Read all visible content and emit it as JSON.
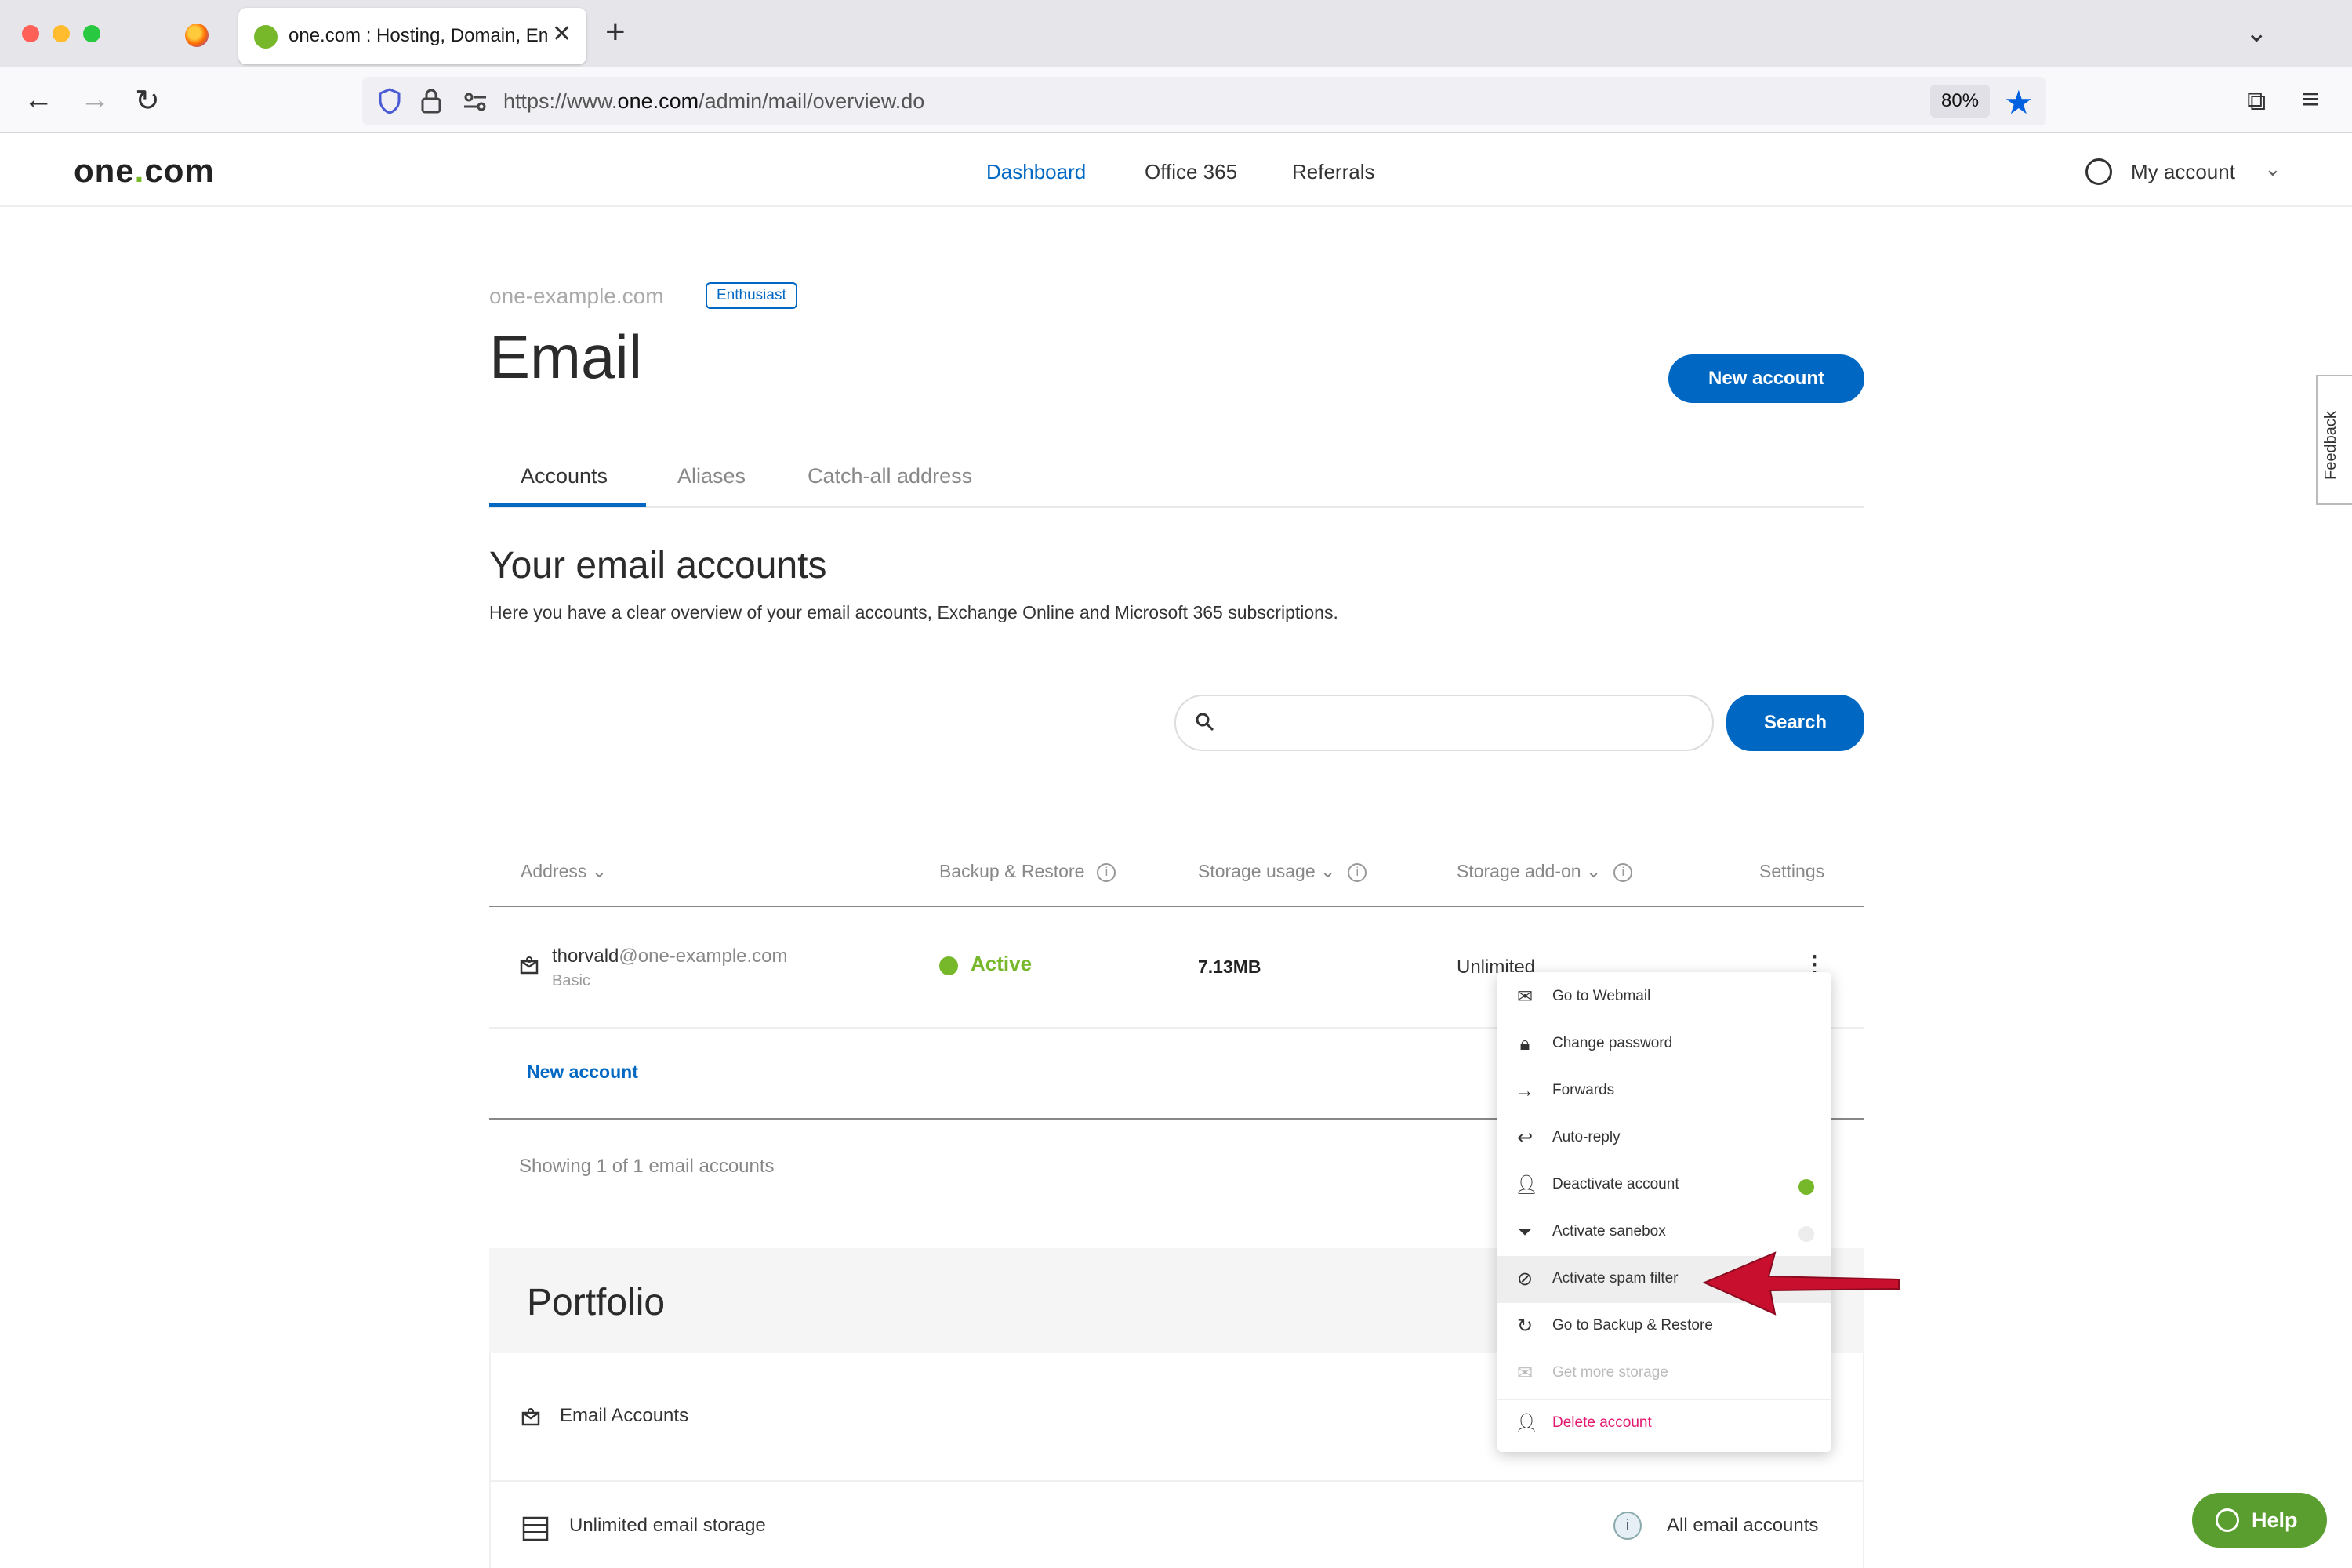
{
  "browser": {
    "tab_title": "one.com : Hosting, Domain, Email",
    "url_prefix": "https://www.",
    "url_host": "one.com",
    "url_path": "/admin/mail/overview.do",
    "zoom": "80%"
  },
  "header": {
    "logo_main": "one",
    "logo_dot": ".",
    "logo_end": "com",
    "nav": [
      "Dashboard",
      "Office 365",
      "Referrals"
    ],
    "active_nav": "Dashboard",
    "my_account": "My account"
  },
  "page": {
    "domain": "one-example.com",
    "plan_badge": "Enthusiast",
    "title": "Email",
    "new_account_button": "New account",
    "tabs": [
      "Accounts",
      "Aliases",
      "Catch-all address"
    ],
    "section_title": "Your email accounts",
    "section_desc": "Here you have a clear overview of your email accounts, Exchange Online and Microsoft 365 subscriptions.",
    "search_button": "Search",
    "search_placeholder": ""
  },
  "table": {
    "headers": {
      "address": "Address",
      "backup": "Backup & Restore",
      "storage": "Storage usage",
      "addon": "Storage add-on",
      "settings": "Settings"
    },
    "rows": [
      {
        "user": "thorvald",
        "domain": "@one-example.com",
        "plan": "Basic",
        "backup_status": "Active",
        "storage_usage": "7.13MB",
        "storage_addon": "Unlimited"
      }
    ],
    "new_account_link": "New account",
    "showing": "Showing 1 of 1 email accounts"
  },
  "menu": {
    "items": [
      {
        "label": "Go to Webmail",
        "icon": "envelope-icon"
      },
      {
        "label": "Change password",
        "icon": "lock-icon"
      },
      {
        "label": "Forwards",
        "icon": "arrow-right-icon"
      },
      {
        "label": "Auto-reply",
        "icon": "reply-icon"
      },
      {
        "label": "Deactivate account",
        "icon": "user-icon",
        "toggle": "on"
      },
      {
        "label": "Activate sanebox",
        "icon": "filter-icon",
        "toggle": "off"
      },
      {
        "label": "Activate spam filter",
        "icon": "block-icon",
        "highlighted": true
      },
      {
        "label": "Go to Backup & Restore",
        "icon": "restore-icon"
      },
      {
        "label": "Get more storage",
        "icon": "storage-icon",
        "disabled": true
      },
      {
        "label": "Delete account",
        "icon": "delete-user-icon",
        "danger": true
      }
    ]
  },
  "portfolio": {
    "title": "Portfolio",
    "rows": [
      {
        "label": "Email Accounts",
        "icon": "mailbox-icon"
      },
      {
        "label": "Unlimited email storage",
        "icon": "storage-icon",
        "right": "All email accounts"
      }
    ]
  },
  "feedback": "Feedback",
  "help": "Help",
  "colors": {
    "brand_blue": "#0068c3",
    "brand_green": "#76b82a",
    "danger": "#e2186f",
    "annotation_arrow": "#c8102e"
  }
}
